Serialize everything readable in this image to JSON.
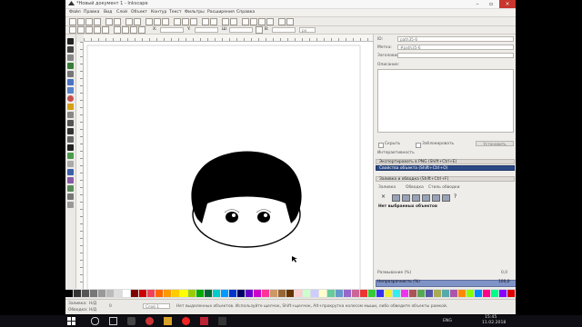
{
  "window": {
    "title": "*Новый документ 1 - Inkscape"
  },
  "menu": {
    "items": [
      "Файл",
      "Правка",
      "Вид",
      "Слой",
      "Объект",
      "Контур",
      "Текст",
      "Фильтры",
      "Расширения",
      "Справка"
    ]
  },
  "toolbar": {
    "x_label": "X:",
    "y_label": "Y:",
    "w_label": "Ш:",
    "h_label": "В:",
    "unit": "px"
  },
  "panel": {
    "id_label": "ID:",
    "id_value": "path35-6",
    "label_label": "Метка:",
    "label_value": "#path35-6",
    "title_label": "Заголовок:",
    "desc_label": "Описание:",
    "hide_label": "Скрыть",
    "lock_label": "Заблокировать",
    "set_button": "Установить",
    "interactivity_label": "Интерактивность",
    "sections": [
      "Экспортировать в PNG (Shift+Ctrl+E)",
      "Свойства объекта (Shift+Ctrl+O)",
      "Заливка и обводка (Shift+Ctrl+F)"
    ],
    "fill_tabs": [
      "Заливка",
      "Обводка",
      "Стиль обводки"
    ],
    "no_selection": "Нет выбранных объектов",
    "blur_label": "Размывание (%)",
    "blur_value": "0,0",
    "opacity_label": "Непрозрачность (%)",
    "opacity_value": "100,0"
  },
  "status": {
    "fill_label": "Заливка:",
    "stroke_label": "Обводка:",
    "fill_value": "Н/Д",
    "stroke_value": "Н/Д",
    "opacity_value": "0",
    "layer": "Слой 1",
    "message": "Нет выделенных объектов. Используйте щелчок, Shift+щелчок, Alt+прокрутка колесом мыши, либо обведите объекты рамкой."
  },
  "taskbar": {
    "lang": "ENG",
    "time": "15:45",
    "date": "11.02.2018"
  },
  "colors": {
    "selected_section": "#2c4a86",
    "opacity_bar": "#7f93c6",
    "drawing_fill": "#000000"
  }
}
